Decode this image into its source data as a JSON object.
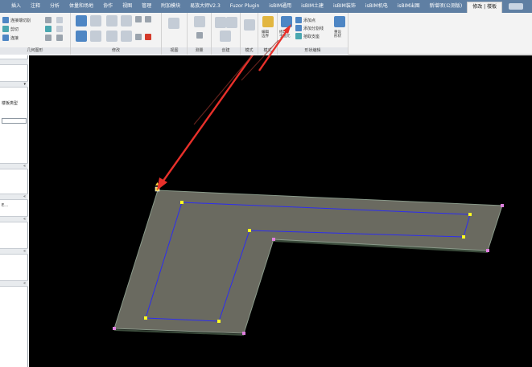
{
  "app": {
    "tabs": [
      {
        "label": "插入"
      },
      {
        "label": "注释"
      },
      {
        "label": "分析"
      },
      {
        "label": "体量和场地"
      },
      {
        "label": "协作"
      },
      {
        "label": "视图"
      },
      {
        "label": "管理"
      },
      {
        "label": "附加模块"
      },
      {
        "label": "易族大师V2.3"
      },
      {
        "label": "Fuzor Plugin"
      },
      {
        "label": "isBIM通用"
      },
      {
        "label": "isBIM土建"
      },
      {
        "label": "isBIM装饰"
      },
      {
        "label": "isBIM机电"
      },
      {
        "label": "isBIM出图"
      },
      {
        "label": "新增项(公测版)"
      },
      {
        "label": "修改 | 楼板"
      }
    ]
  },
  "ribbon": {
    "geometry": {
      "title": "几何图形",
      "items": [
        "连接端切割",
        "剪切",
        "连接"
      ]
    },
    "modify": {
      "title": "修改"
    },
    "view": {
      "title": "视图"
    },
    "measure": {
      "title": "测量"
    },
    "create": {
      "title": "创建"
    },
    "mode": {
      "title": "模式"
    },
    "edit_mode": {
      "title": "模式",
      "edit_boundary_label": "编辑\n边界"
    },
    "shape_editing": {
      "title": "形状编辑",
      "modify_sub_elements_label": "修改\n子图元",
      "add_point_label": "添加点",
      "add_split_line_label": "添加分割线",
      "pick_supports_label": "拾取支座",
      "reset_shape_label": "重设\n形状"
    }
  },
  "properties_palette": {
    "type_label": "楼板类型",
    "truncated_text": "E..."
  },
  "canvas": {
    "background": "#000000",
    "floor_fill": "#6a6a60",
    "edge_line_color": "#2d2df0",
    "vertex_color": "#ffff22",
    "corner_color": "#e080e0",
    "arrow_color": "#e8302a"
  }
}
